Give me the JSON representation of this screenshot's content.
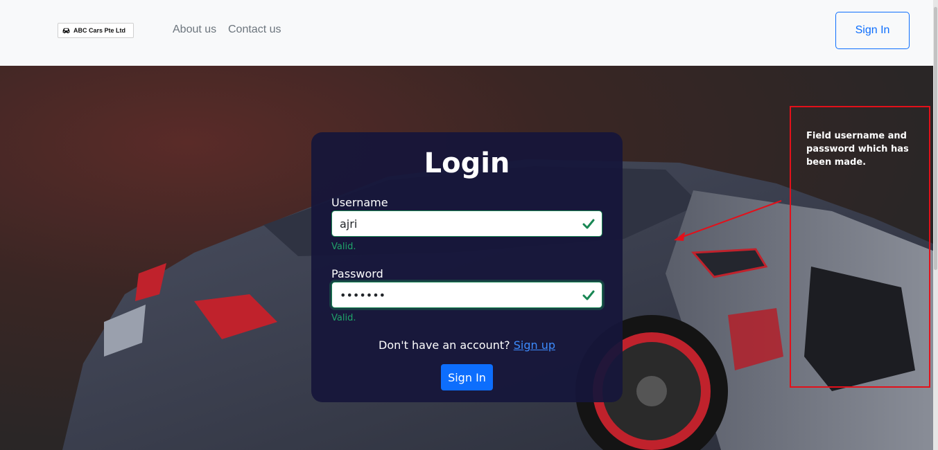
{
  "navbar": {
    "brand": "ABC Cars Pte Ltd",
    "links": [
      "About us",
      "Contact us"
    ],
    "signin_button": "Sign In"
  },
  "login": {
    "title": "Login",
    "username_label": "Username",
    "username_value": "ajri",
    "username_feedback": "Valid.",
    "password_label": "Password",
    "password_value": "1234567",
    "password_feedback": "Valid.",
    "signup_prompt": "Don't have an account?",
    "signup_link": "Sign up",
    "submit_button": "Sign In"
  },
  "annotation": {
    "note": "Field username and password which has been made."
  },
  "colors": {
    "primary": "#0d6efd",
    "valid": "#198754",
    "card_bg": "#16163a",
    "annotation": "#e3101a"
  },
  "icons": [
    "car-icon",
    "check-icon",
    "check-icon"
  ]
}
